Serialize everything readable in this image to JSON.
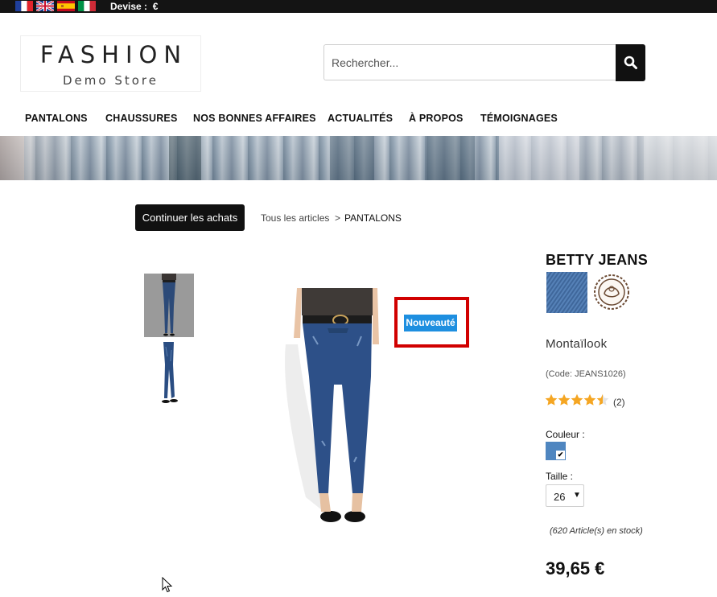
{
  "topbar": {
    "flags": [
      "flag-france-icon",
      "flag-uk-icon",
      "flag-spain-icon",
      "flag-italy-icon"
    ],
    "devise_label": "Devise :  €"
  },
  "logo": {
    "title": "FASHION",
    "subtitle": "Demo Store"
  },
  "search": {
    "placeholder": "Rechercher...",
    "icon": "search-icon"
  },
  "nav": {
    "items": [
      "PANTALONS",
      "CHAUSSURES",
      "NOS BONNES AFFAIRES",
      "ACTUALITÉS",
      "À PROPOS",
      "TÉMOIGNAGES"
    ]
  },
  "breadcrumb": {
    "continue_label": "Continuer les achats",
    "link": "Tous les articles",
    "separator": ">",
    "current": "PANTALONS"
  },
  "product": {
    "badge": "Nouveauté",
    "name": "BETTY JEANS",
    "brand": "Montaïlook",
    "code": "(Code: JEANS1026)",
    "rating": 4.5,
    "rating_max": 5,
    "review_count": "(2)",
    "color_label": "Couleur :",
    "selected_color": "#4f86c0",
    "size_label": "Taille :",
    "size_value": "26",
    "stock": "(620 Article(s) en stock)",
    "price": "39,65 €"
  },
  "colors": {
    "badge_bg": "#1e8fe0",
    "highlight_border": "#d10000",
    "star": "#f5a623",
    "topbar_bg": "#141414"
  }
}
